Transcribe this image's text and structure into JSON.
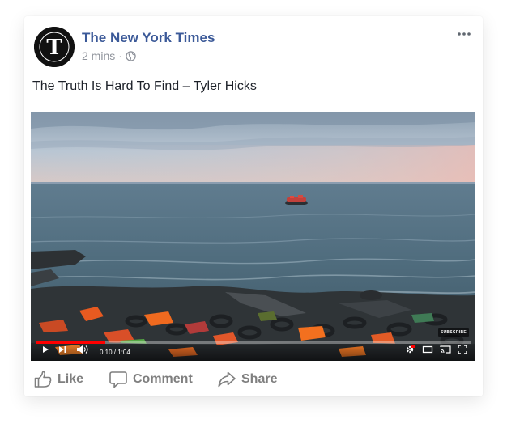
{
  "post": {
    "page_name": "The New York Times",
    "avatar_letter": "T",
    "time": "2 mins",
    "separator": "·",
    "audience_icon": "globe-icon",
    "more_icon": "ellipsis-icon",
    "text": "The Truth Is Hard To Find – Tyler Hicks"
  },
  "video": {
    "time": "0:10 / 1:04",
    "progress": 0.16,
    "subscribe": "SUBSCRIBE",
    "accent_color": "#ff0000",
    "icons": [
      "play-icon",
      "next-icon",
      "volume-icon",
      "settings-icon",
      "theater-icon",
      "cast-icon",
      "fullscreen-icon"
    ]
  },
  "actions": {
    "like": "Like",
    "comment": "Comment",
    "share": "Share"
  },
  "colors": {
    "page_name": "#3b5998",
    "meta": "#90949c",
    "action": "#7f7f7f"
  }
}
